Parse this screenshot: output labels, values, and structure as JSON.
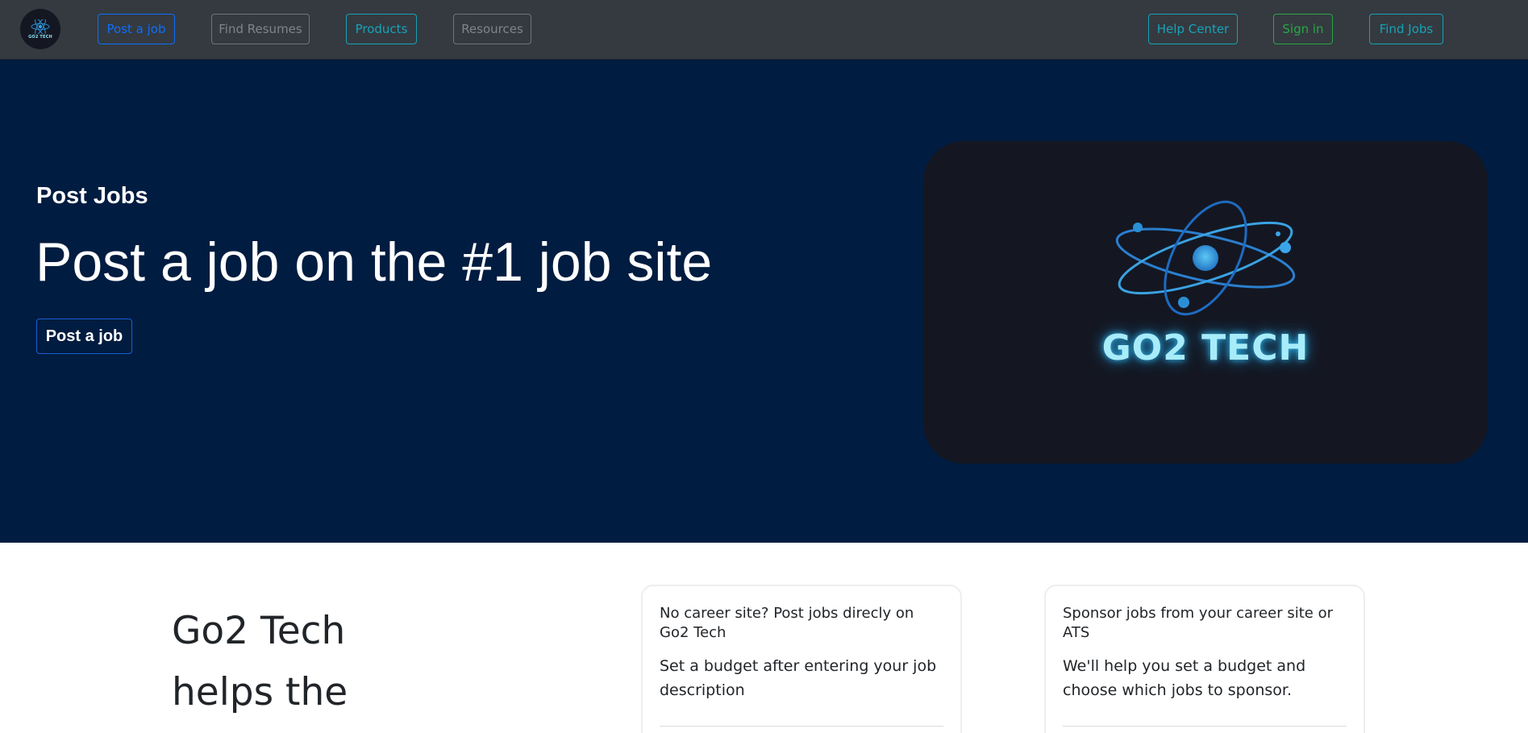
{
  "navbar": {
    "logo_text": "GO2 TECH",
    "buttons": [
      {
        "label": "Post a job"
      },
      {
        "label": "Find Resumes"
      },
      {
        "label": "Products"
      },
      {
        "label": "Resources"
      },
      {
        "label": "Help Center"
      },
      {
        "label": "Sign in"
      },
      {
        "label": "Find Jobs"
      }
    ]
  },
  "hero": {
    "eyebrow": "Post Jobs",
    "title": "Post a job on the #1 job site",
    "cta_label": "Post a job",
    "brand_text": "GO2 TECH"
  },
  "lower": {
    "heading": "Go2 Tech helps the",
    "cards": [
      {
        "title": "No career site? Post jobs direcly on Go2 Tech",
        "text": "Set a budget after entering your job description"
      },
      {
        "title": "Sponsor jobs from your career site or ATS",
        "text": "We'll help you set a budget and choose which jobs to sponsor."
      }
    ]
  },
  "colors": {
    "navbar_bg": "#343a40",
    "hero_bg": "#001c40",
    "primary": "#0d6efd",
    "info": "#17a2b8",
    "success": "#28a745",
    "secondary": "#6c757d"
  }
}
